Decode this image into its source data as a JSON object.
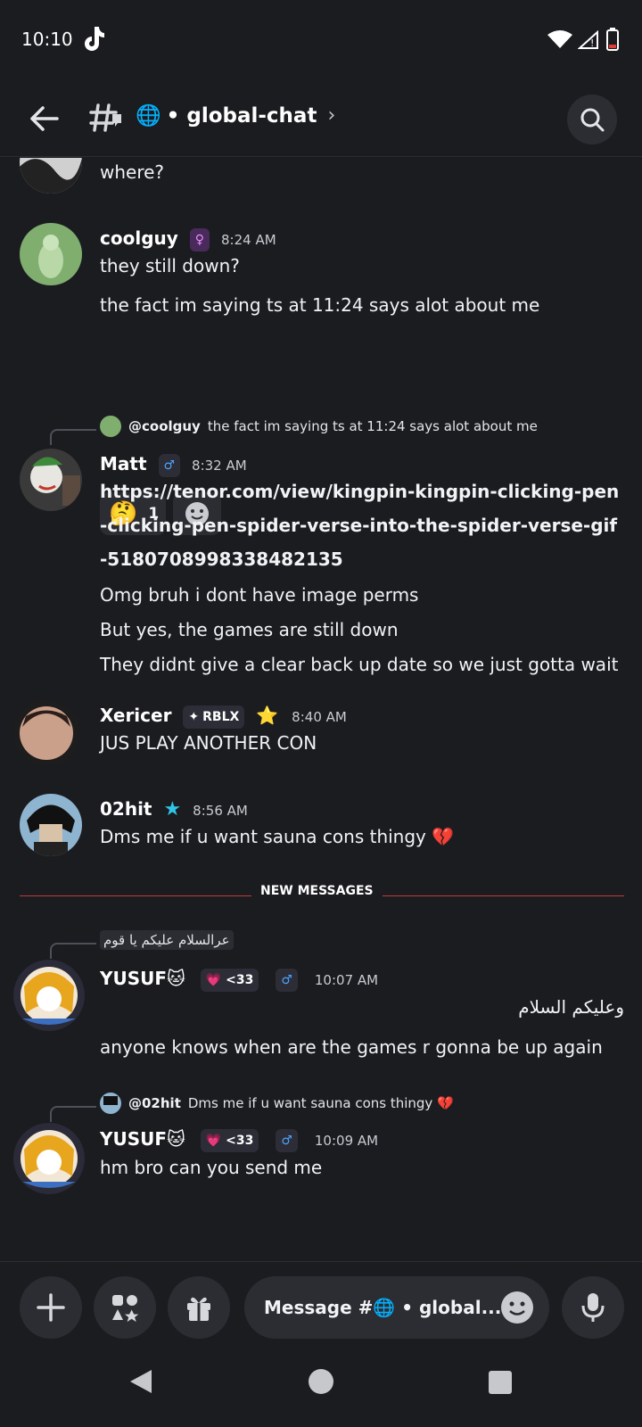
{
  "status": {
    "time": "10:10"
  },
  "header": {
    "channel_emoji": "🌐",
    "channel_name": "• global-chat",
    "chevron": "›"
  },
  "messages": {
    "partial": {
      "text": "where?"
    },
    "coolguy": {
      "name": "coolguy",
      "gender_badge": "♀",
      "time": "8:24 AM",
      "lines": [
        "they still down?",
        "the fact im saying ts at 11:24 says alot about me"
      ],
      "reaction": {
        "emoji": "🤔",
        "count": "1"
      }
    },
    "matt": {
      "reply_user": "@coolguy",
      "reply_text": "the fact im saying ts at 11:24 says alot about me",
      "name": "Matt",
      "gender_badge": "♂",
      "time": "8:32 AM",
      "lines": [
        "https://tenor.com/view/kingpin-kingpin-clicking-pen",
        "-clicking-pen-spider-verse-into-the-spider-verse-gif",
        "-5180708998338482135",
        "Omg bruh i dont have image perms",
        "But yes, the games are still down",
        "They didnt give a clear back up date so we just gotta wait"
      ]
    },
    "xericer": {
      "name": "Xericer",
      "tag": "RBLX",
      "star": "⭐",
      "time": "8:40 AM",
      "text": "JUS PLAY ANOTHER CON"
    },
    "o2hit": {
      "name": "02hit",
      "time": "8:56 AM",
      "text": "Dms me if u want sauna cons thingy 💔"
    },
    "divider": "NEW MESSAGES",
    "yusuf1": {
      "reply_text": "عرالسلام عليكم يا قوم",
      "name": "YUSUF🐱",
      "heart_badge": "💗 <33",
      "gender_badge": "♂",
      "time": "10:07 AM",
      "arabic": "وعليكم السلام",
      "text": "anyone knows when are the games r gonna be up again"
    },
    "yusuf2": {
      "reply_user": "@02hit",
      "reply_text": "Dms me if u want sauna cons thingy 💔",
      "name": "YUSUF🐱",
      "heart_badge": "💗 <33",
      "gender_badge": "♂",
      "time": "10:09 AM",
      "text": "hm bro can you send me"
    }
  },
  "composer": {
    "placeholder": "Message #🌐 • global..."
  },
  "colors": {
    "background": "#1b1c20",
    "surface": "#2b2d33",
    "divider": "#c13b3b",
    "male_badge": "#2f6db0",
    "female_badge": "#9b3fb5"
  }
}
